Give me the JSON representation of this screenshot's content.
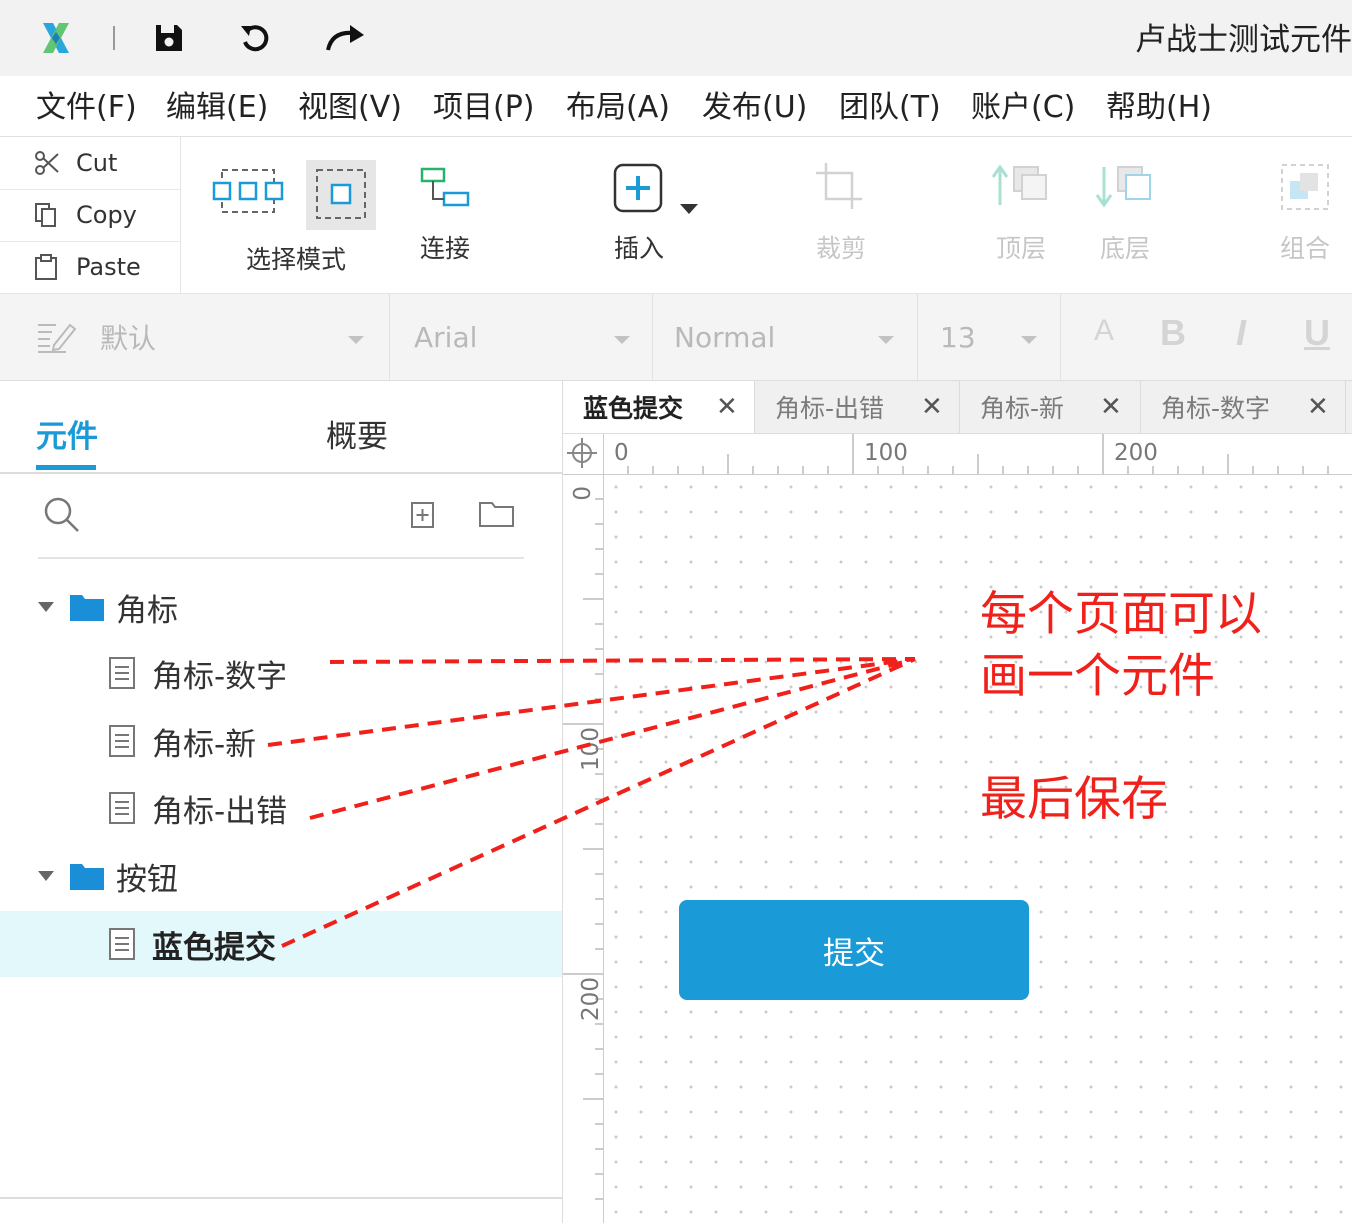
{
  "app": {
    "title": "卢战士测试元件"
  },
  "menu": [
    "文件(F)",
    "编辑(E)",
    "视图(V)",
    "项目(P)",
    "布局(A)",
    "发布(U)",
    "团队(T)",
    "账户(C)",
    "帮助(H)"
  ],
  "clipboard": {
    "cut": "Cut",
    "copy": "Copy",
    "paste": "Paste"
  },
  "toolbar": {
    "select_mode": "选择模式",
    "connect": "连接",
    "insert": "插入",
    "crop": "裁剪",
    "top_layer": "顶层",
    "bottom_layer": "底层",
    "group": "组合"
  },
  "format": {
    "style": "默认",
    "font": "Arial",
    "weight": "Normal",
    "size": "13",
    "text_color": "A",
    "bold": "B",
    "italic": "I",
    "underline": "U"
  },
  "left_panel": {
    "tabs": [
      "元件",
      "概要"
    ],
    "active_tab": "元件",
    "tree": [
      {
        "label": "角标",
        "type": "folder"
      },
      {
        "label": "角标-数字",
        "type": "page"
      },
      {
        "label": "角标-新",
        "type": "page"
      },
      {
        "label": "角标-出错",
        "type": "page"
      },
      {
        "label": "按钮",
        "type": "folder"
      },
      {
        "label": "蓝色提交",
        "type": "page",
        "selected": true
      }
    ]
  },
  "page_tabs": [
    {
      "label": "蓝色提交",
      "active": true
    },
    {
      "label": "角标-出错"
    },
    {
      "label": "角标-新"
    },
    {
      "label": "角标-数字"
    }
  ],
  "rulers": {
    "top": [
      "0",
      "100",
      "200"
    ],
    "left": [
      "0",
      "100",
      "200"
    ]
  },
  "canvas": {
    "button_label": "提交",
    "button_color": "#1a9ad6"
  },
  "annotation": {
    "line1": "每个页面可以",
    "line2": "画一个元件",
    "line3": "最后保存",
    "color": "#f0201a"
  }
}
